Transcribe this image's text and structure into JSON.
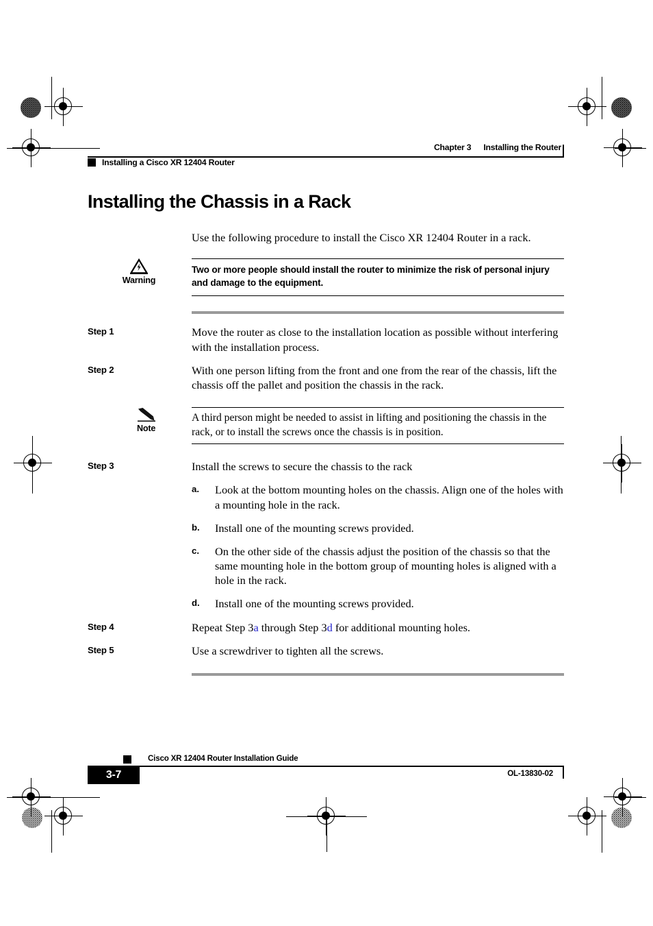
{
  "header": {
    "chapter": "Chapter 3",
    "chapter_title": "Installing the Router",
    "running_head": "Installing a Cisco XR 12404 Router"
  },
  "page_title": "Installing the Chassis in a Rack",
  "intro": "Use the following procedure to install the Cisco XR 12404 Router in a rack.",
  "warning": {
    "label": "Warning",
    "text": "Two or more people should install the router to minimize the risk of personal injury and damage to the equipment."
  },
  "note": {
    "label": "Note",
    "text": "A third person might be needed to assist in lifting and positioning the chassis in the rack, or to install the screws once the chassis is in position."
  },
  "steps": {
    "step1": {
      "label": "Step 1",
      "text": "Move the router as close to the installation location as possible without interfering with the installation process."
    },
    "step2": {
      "label": "Step 2",
      "text": "With one person lifting from the front and one from the rear of the chassis, lift the chassis off the pallet and position the chassis in the rack."
    },
    "step3": {
      "label": "Step 3",
      "text": "Install the screws to secure the chassis to the rack"
    },
    "step4": {
      "label": "Step 4",
      "text_before": "Repeat Step ",
      "ref1_num": "3",
      "ref1_letter": "a",
      "text_middle": " through Step ",
      "ref2_num": "3",
      "ref2_letter": "d",
      "text_after": " for additional mounting holes."
    },
    "step5": {
      "label": "Step 5",
      "text": "Use a screwdriver to tighten all the screws."
    }
  },
  "substeps": [
    {
      "label": "a.",
      "text": "Look at the bottom mounting holes on the chassis. Align one of the holes with a mounting hole in the rack."
    },
    {
      "label": "b.",
      "text": "Install one of the mounting screws provided."
    },
    {
      "label": "c.",
      "text": "On the other side of the chassis adjust the position of the chassis so that the same mounting hole in the bottom group of mounting holes is aligned with a hole in the rack."
    },
    {
      "label": "d.",
      "text": "Install one of the mounting screws provided."
    }
  ],
  "footer": {
    "page_number": "3-7",
    "guide_title": "Cisco XR 12404 Router Installation Guide",
    "doc_id": "OL-13830-02"
  },
  "colors": {
    "xref_link": "#2222cc",
    "rule_gray": "#9a9a9a",
    "ink": "#000000"
  }
}
